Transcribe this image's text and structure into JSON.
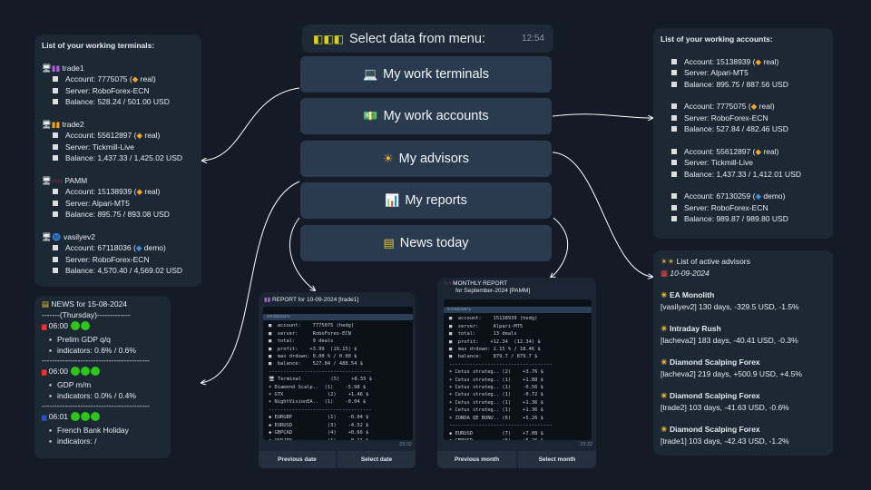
{
  "menu": {
    "title": "Select data from menu:",
    "time": "12:54",
    "title_icon": "beginner-badge-icon",
    "buttons": [
      {
        "icon": "laptop-icon",
        "label": "My work terminals"
      },
      {
        "icon": "money-icon",
        "label": "My work accounts"
      },
      {
        "icon": "sun-icon",
        "label": "My advisors"
      },
      {
        "icon": "bar-chart-icon",
        "label": "My reports"
      },
      {
        "icon": "newspaper-icon",
        "label": "News today"
      }
    ]
  },
  "terminals": {
    "title": "List of your working terminals:",
    "items": [
      {
        "name": "trade1",
        "account": "Account:  7775075 (",
        "type": "real)",
        "server": "Server:    RoboForex-ECN",
        "balance": "Balance:  528.24 / 501.00 USD"
      },
      {
        "name": "trade2",
        "account": "Account:  55612897 (",
        "type": "real)",
        "server": "Server:    Tickmill-Live",
        "balance": "Balance:  1,437.33 / 1,425.02 USD"
      },
      {
        "name": "PAMM",
        "account": "Account:  15138939 (",
        "type": "real)",
        "server": "Server:    Alpari-MT5",
        "balance": "Balance:  895.75 / 893.08 USD"
      },
      {
        "name": "vasilyev2",
        "account": "Account:  67118036 (",
        "type": "demo)",
        "server": "Server:    RoboForex-ECN",
        "balance": "Balance:  4,570.40 / 4,569.02 USD"
      }
    ]
  },
  "accounts": {
    "title": "List of your working accounts:",
    "items": [
      {
        "account": "Account:  15138939 (",
        "type": "real)",
        "server": "Server:    Alpari-MT5",
        "balance": "Balance:  895.75 / 887.56 USD"
      },
      {
        "account": "Account:  7775075 (",
        "type": "real)",
        "server": "Server:    RoboForex-ECN",
        "balance": "Balance:  527.84 / 482.46 USD"
      },
      {
        "account": "Account:  55612897 (",
        "type": "real)",
        "server": "Server:    Tickmill-Live",
        "balance": "Balance:  1,437.33 / 1,412.01 USD"
      },
      {
        "account": "Account:  67130259 (",
        "type": "demo)",
        "server": "Server:    RoboForex-ECN",
        "balance": "Balance:  989.87 / 989.80 USD"
      }
    ]
  },
  "advisors": {
    "title": "List of active advisors",
    "date": "10-09-2024",
    "items": [
      {
        "name": "EA Monolith",
        "detail": "[vasilyev2] 130 days, -329.5 USD, -1.5%"
      },
      {
        "name": "Intraday Rush",
        "detail": "[lacheva2] 183 days, -40.41 USD, -0.3%"
      },
      {
        "name": "Diamond Scalping Forex",
        "detail": "[lacheva2] 219 days, +500.9 USD, +4.5%"
      },
      {
        "name": "Diamond Scalping Forex",
        "detail": "[trade2] 103 days, -41.63 USD, -0.6%"
      },
      {
        "name": "Diamond Scalping Forex",
        "detail": "[trade1] 103 days, -42.43 USD, -1.2%"
      }
    ]
  },
  "news": {
    "title": "NEWS for 15-08-2024",
    "day": "-------(Thursday)-------------",
    "sep": "------------------------------------------",
    "items": [
      {
        "flag": "uk-flag-icon",
        "time": "06:00",
        "impact": 2,
        "event": "Prelim GDP q/q",
        "ind": "indicators: 0.6% / 0.6%"
      },
      {
        "flag": "uk-flag-icon",
        "time": "06:00",
        "impact": 3,
        "event": "GDP m/m",
        "ind": "indicators: 0.0% / 0.4%"
      },
      {
        "flag": "eu-flag-icon",
        "time": "06:01",
        "impact": 3,
        "event": "French Bank Holiday",
        "ind": "indicators:  /"
      }
    ]
  },
  "report_daily": {
    "title": "REPORT for 10-09-2024 [trade1]",
    "copy": "копировать",
    "time": "23:32",
    "prev": "Previous date",
    "select": "Select date",
    "lines": [
      "■  account:    7775075 (hedg)",
      "■  server:     RoboForex-ECN",
      "■  total:      9 deals",
      "■  profit:    +3.99  (19.15) $",
      "■  max drdown: 0.00 % / 0.00 $",
      "■  balance:    527.84 / 488.54 $",
      "-----------------------------------",
      "🖥 Terminal          (5)    +8.55 $",
      "☀ Diamond Scalp..  (1)    -5.98 $",
      "☀ GTX               (2)    +1.46 $",
      "☀ NightVisionEA..  (1)    -0.04 $",
      "-----------------------------------",
      "◆ EURGBP            (1)    -0.04 $",
      "◆ EURUSD            (3)    -4.52 $",
      "◆ GBPCAD            (4)    +0.66 $",
      "◆ USDJPY            (1)    -0.11 $"
    ]
  },
  "report_monthly": {
    "title": "MONTHLY REPORT",
    "subtitle": "for September-2024 [PAMM]",
    "copy": "копировать",
    "time": "23:32",
    "prev": "Previous month",
    "select": "Select month",
    "lines": [
      "■  account:    15138939 (hedg)",
      "■  server:     Alpari-MT5",
      "■  total:      13 deals",
      "■  profit:    +12.34  (12.34) $",
      "■  max drdown: 2.15 % / 18.46 $",
      "■  balance:    879.7 / 879.7 $",
      "-----------------------------------",
      "☀ Cetus strateg.. (2)    +3.76 $",
      "☀ Cetus strateg.. (1)    +1.88 $",
      "☀ Cetus strateg.. (1)    -0.56 $",
      "☀ Cetus strateg.. (1)    -0.72 $",
      "☀ Cetus strateg.. (1)    +1.36 $",
      "☀ Cetus strateg.. (1)    +1.36 $",
      "☀ ZONDA QE BONU.. (6)    +5.26 $",
      "-----------------------------------",
      "◆ EURUSD          (7)    +7.08 $",
      "◆ GBPUSD          (6)    +5.26 $"
    ]
  },
  "colors": {
    "background": "#141b26",
    "panel": "#1d2835",
    "button": "#2a3b4f",
    "real": "#f5a623",
    "demo": "#3b8fe0",
    "impact": "#2ec41c"
  }
}
